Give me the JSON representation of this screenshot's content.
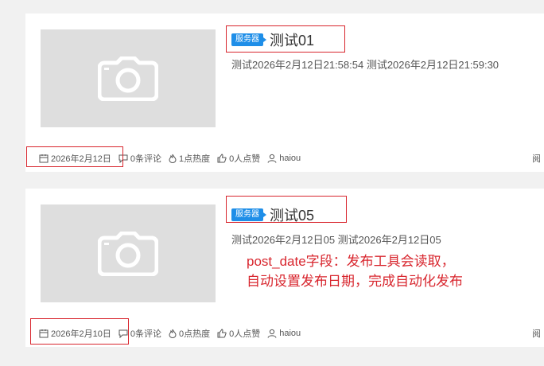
{
  "posts": [
    {
      "category": "服务器",
      "title": "测试01",
      "excerpt": "测试2026年2月12日21:58:54 测试2026年2月12日21:59:30",
      "date": "2026年2月12日",
      "comments": "0条评论",
      "heat": "1点热度",
      "likes": "0人点赞",
      "author": "haiou",
      "right_partial": "阅"
    },
    {
      "category": "服务器",
      "title": "测试05",
      "excerpt": "测试2026年2月12日05 测试2026年2月12日05",
      "date": "2026年2月10日",
      "comments": "0条评论",
      "heat": "0点热度",
      "likes": "0人点赞",
      "author": "haiou",
      "right_partial": "阅"
    }
  ],
  "annotation": {
    "line1": "post_date字段：发布工具会读取，",
    "line2": "自动设置发布日期，完成自动化发布"
  },
  "colors": {
    "badge": "#1e8ee8",
    "annotation_red": "#d8262e",
    "thumbnail_bg": "#dedede"
  },
  "icons": [
    "camera-icon",
    "calendar-icon",
    "comment-icon",
    "flame-icon",
    "thumbs-up-icon",
    "user-icon"
  ]
}
